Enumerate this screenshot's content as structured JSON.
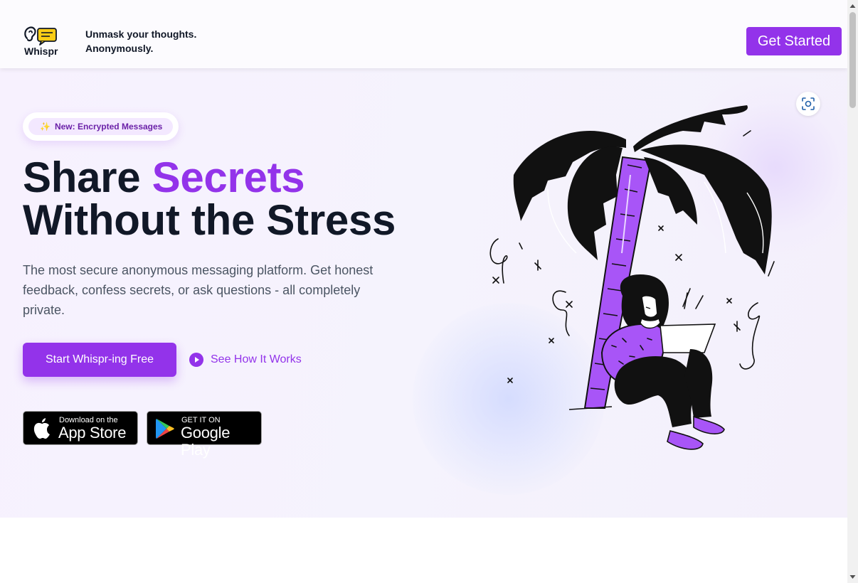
{
  "header": {
    "logo_text": "Whispr",
    "tagline_line1": "Unmask your thoughts.",
    "tagline_line2": "Anonymously.",
    "cta_label": "Get Started"
  },
  "hero": {
    "badge": "New: Encrypted Messages",
    "headline_part1": "Share ",
    "headline_accent": "Secrets",
    "headline_line2": "Without the Stress",
    "description": "The most secure anonymous messaging platform. Get honest feedback, confess secrets, or ask questions - all completely private.",
    "primary_button": "Start Whispr-ing Free",
    "secondary_link": "See How It Works",
    "app_store": {
      "small": "Download on the",
      "big": "App Store"
    },
    "google_play": {
      "small": "GET IT ON",
      "big": "Google Play"
    }
  },
  "colors": {
    "brand": "#9333ea",
    "text_dark": "#111827",
    "text_muted": "#4b5563",
    "badge_bg": "#f3e8ff"
  },
  "icons": [
    "ear-chat-logo-icon",
    "sparkles-icon",
    "play-circle-icon",
    "apple-icon",
    "google-play-icon",
    "scan-icon"
  ]
}
